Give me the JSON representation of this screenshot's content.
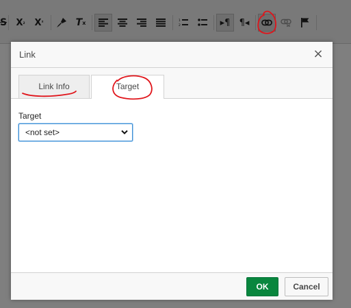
{
  "toolbar": {
    "buttons": [
      {
        "name": "strikethrough",
        "glyph": "S"
      },
      {
        "name": "subscript",
        "glyph": "X₂"
      },
      {
        "name": "superscript",
        "glyph": "X²"
      },
      {
        "name": "copy-formatting",
        "glyph": "🖌"
      },
      {
        "name": "remove-format",
        "glyph": "Tx"
      },
      {
        "name": "align-left",
        "glyph": "align-left"
      },
      {
        "name": "align-center",
        "glyph": "align-center"
      },
      {
        "name": "align-right",
        "glyph": "align-right"
      },
      {
        "name": "justify",
        "glyph": "justify"
      },
      {
        "name": "numbered-list",
        "glyph": "numbered-list"
      },
      {
        "name": "bulleted-list",
        "glyph": "bulleted-list"
      },
      {
        "name": "text-direction-ltr",
        "glyph": "¶"
      },
      {
        "name": "text-direction-rtl",
        "glyph": "¶"
      },
      {
        "name": "link",
        "glyph": "link-icon"
      },
      {
        "name": "unlink",
        "glyph": "unlink-icon"
      },
      {
        "name": "anchor",
        "glyph": "flag-icon"
      }
    ]
  },
  "dialog": {
    "title": "Link",
    "close_glyph": "×",
    "tabs": [
      {
        "label": "Link Info",
        "selected": false
      },
      {
        "label": "Target",
        "selected": true
      }
    ],
    "target": {
      "label": "Target",
      "value": "<not set>"
    },
    "buttons": {
      "ok": "OK",
      "cancel": "Cancel"
    }
  },
  "colors": {
    "ok_button": "#09863e",
    "annotation": "#e0141a",
    "select_focus": "#3f8fd6"
  }
}
